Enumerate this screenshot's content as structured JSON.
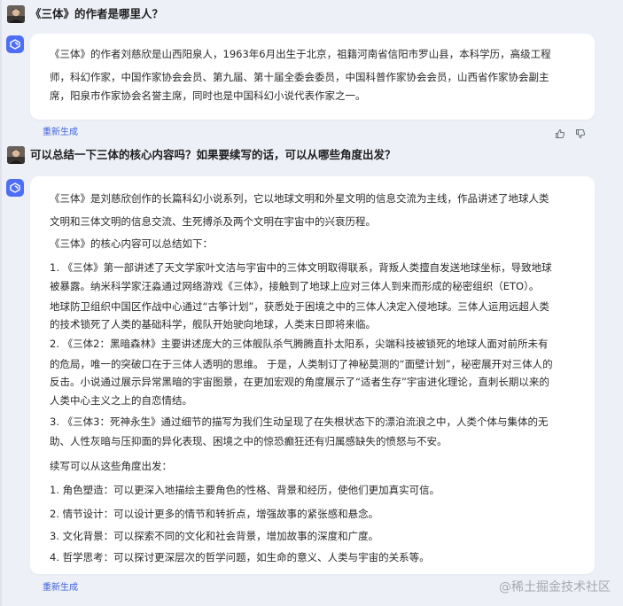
{
  "conversation": [
    {
      "question": "《三体》的作者是哪里人？",
      "answer": [
        "《三体》的作者刘慈欣是山西阳泉人，1963年6月出生于北京，祖籍河南省信阳市罗山县，本科学历，高级工程",
        "师，科幻作家，中国作家协会会员、第九届、第十届全委会委员，中国科普作家协会会员，山西省作家协会副主",
        "席，阳泉市作家协会名誉主席，同时也是中国科幻小说代表作家之一。"
      ],
      "regenerate_label": "重新生成"
    },
    {
      "question": "可以总结一下三体的核心内容吗？如果要续写的话，可以从哪些角度出发？",
      "answer": [
        "《三体》是刘慈欣创作的长篇科幻小说系列，它以地球文明和外星文明的信息交流为主线，作品讲述了地球人类",
        "文明和三体文明的信息交流、生死搏杀及两个文明在宇宙中的兴衰历程。",
        "《三体》的核心内容可以总结如下：",
        "1. 《三体》第一部讲述了天文学家叶文洁与宇宙中的三体文明取得联系，背叛人类擅自发送地球坐标，导致地球",
        "被暴露。纳米科学家汪淼通过网络游戏《三体》，接触到了地球上应对三体人到来而形成的秘密组织（ETO）。",
        "地球防卫组织中国区作战中心通过“古筝计划”，获悉处于困境之中的三体人决定入侵地球。三体人运用远超人类",
        "的技术锁死了人类的基础科学，舰队开始驶向地球，人类末日即将来临。",
        "2. 《三体2：黑暗森林》主要讲述庞大的三体舰队杀气腾腾直扑太阳系，尖端科技被锁死的地球人面对前所未有",
        "的危局，唯一的突破口在于三体人透明的思维。 于是，人类制订了神秘莫测的“面壁计划”，秘密展开对三体人的",
        "反击。小说通过展示异常黑暗的宇宙图景，在更加宏观的角度展示了“适者生存”宇宙进化理论，直刺长期以来的",
        "人类中心主义之上的自恋情结。",
        "3. 《三体3：死神永生》通过细节的描写为我们生动呈现了在失根状态下的漂泊流浪之中，人类个体与集体的无",
        "助、人性灰暗与压抑面的异化表现、困境之中的惊恐癫狂还有归属感缺失的愤怒与不安。",
        "续写可以从这些角度出发：",
        "1. 角色塑造：可以更深入地描绘主要角色的性格、背景和经历，使他们更加真实可信。",
        "2. 情节设计：可以设计更多的情节和转折点，增强故事的紧张感和悬念。",
        "3. 文化背景：可以探索不同的文化和社会背景，增加故事的深度和广度。",
        "4. 哲学思考：可以探讨更深层次的哲学问题，如生命的意义、人类与宇宙的关系等。"
      ],
      "regenerate_label": "重新生成"
    }
  ],
  "watermark": "@稀土掘金技术社区",
  "icons": {
    "bot_avatar": "bot-logo-icon",
    "like": "thumb-up-icon",
    "dislike": "thumb-down-icon"
  },
  "colors": {
    "accent": "#3e63dd",
    "bot_avatar_bg": "#4f6ef7",
    "page_bg": "#eef0f7",
    "card_bg": "#ffffff"
  }
}
